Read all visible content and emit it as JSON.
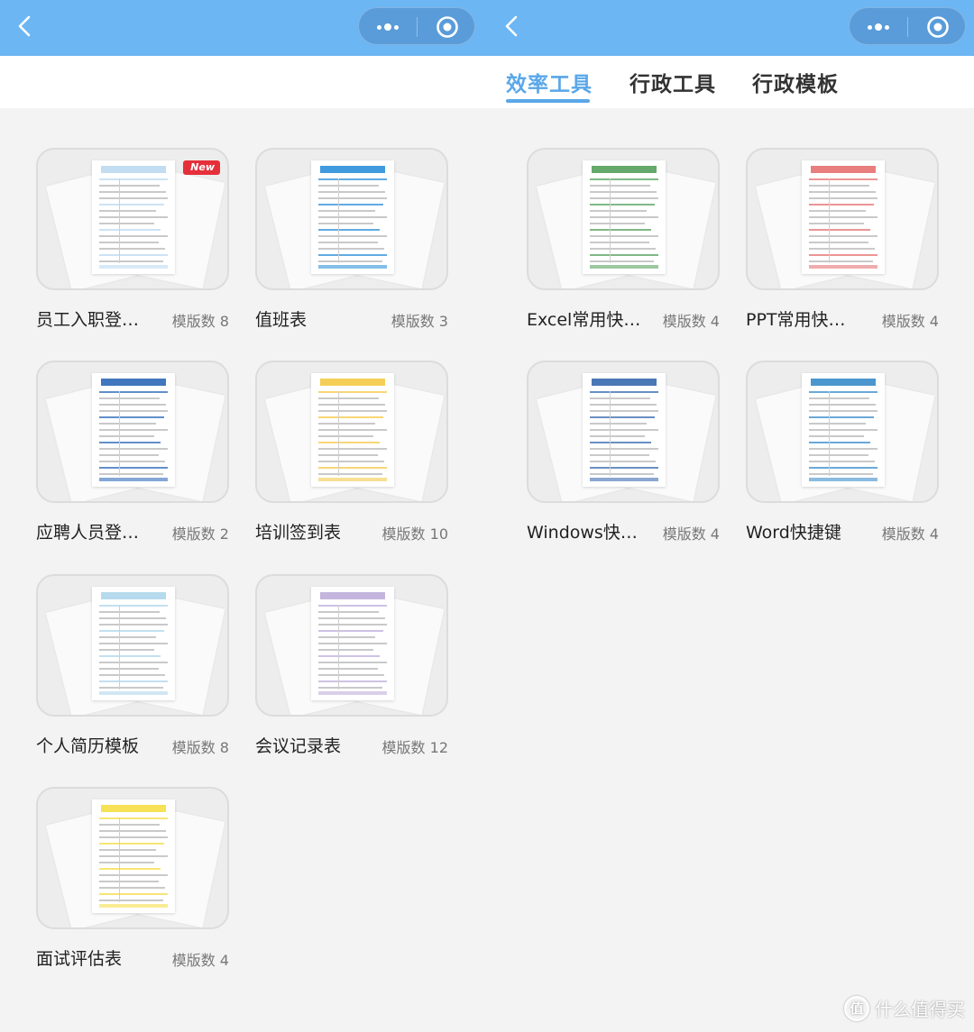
{
  "left_panel": {
    "nav": {
      "back_icon": "chevron-left-icon",
      "more_icon": "more-dots-icon",
      "close_icon": "target-circle-icon"
    },
    "cards": [
      {
        "title": "员工入职登…",
        "count_label": "模版数 8",
        "badge": "New",
        "accent": "#b7d7ef"
      },
      {
        "title": "值班表",
        "count_label": "模版数 3",
        "accent": "#1e88d8"
      },
      {
        "title": "应聘人员登…",
        "count_label": "模版数 2",
        "accent": "#1f5fb4"
      },
      {
        "title": "培训签到表",
        "count_label": "模版数 10",
        "accent": "#f3c53a"
      },
      {
        "title": "个人简历模板",
        "count_label": "模版数 8",
        "accent": "#a9d3ea"
      },
      {
        "title": "会议记录表",
        "count_label": "模版数 12",
        "accent": "#b9a8d8"
      },
      {
        "title": "面试评估表",
        "count_label": "模版数 4",
        "accent": "#f4dc3a"
      }
    ]
  },
  "right_panel": {
    "nav": {
      "back_icon": "chevron-left-icon",
      "more_icon": "more-dots-icon",
      "close_icon": "target-circle-icon"
    },
    "tabs": [
      {
        "label": "效率工具",
        "active": true
      },
      {
        "label": "行政工具",
        "active": false
      },
      {
        "label": "行政模板",
        "active": false
      }
    ],
    "cards": [
      {
        "title": "Excel常用快…",
        "count_label": "模版数 4",
        "accent": "#4a9a52"
      },
      {
        "title": "PPT常用快…",
        "count_label": "模版数 4",
        "accent": "#e46767"
      },
      {
        "title": "Windows快…",
        "count_label": "模版数 4",
        "accent": "#2a5fa8"
      },
      {
        "title": "Word快捷键",
        "count_label": "模版数 4",
        "accent": "#2b84c6"
      }
    ]
  },
  "watermark": {
    "text": "什么值得买",
    "logo_char": "值"
  }
}
